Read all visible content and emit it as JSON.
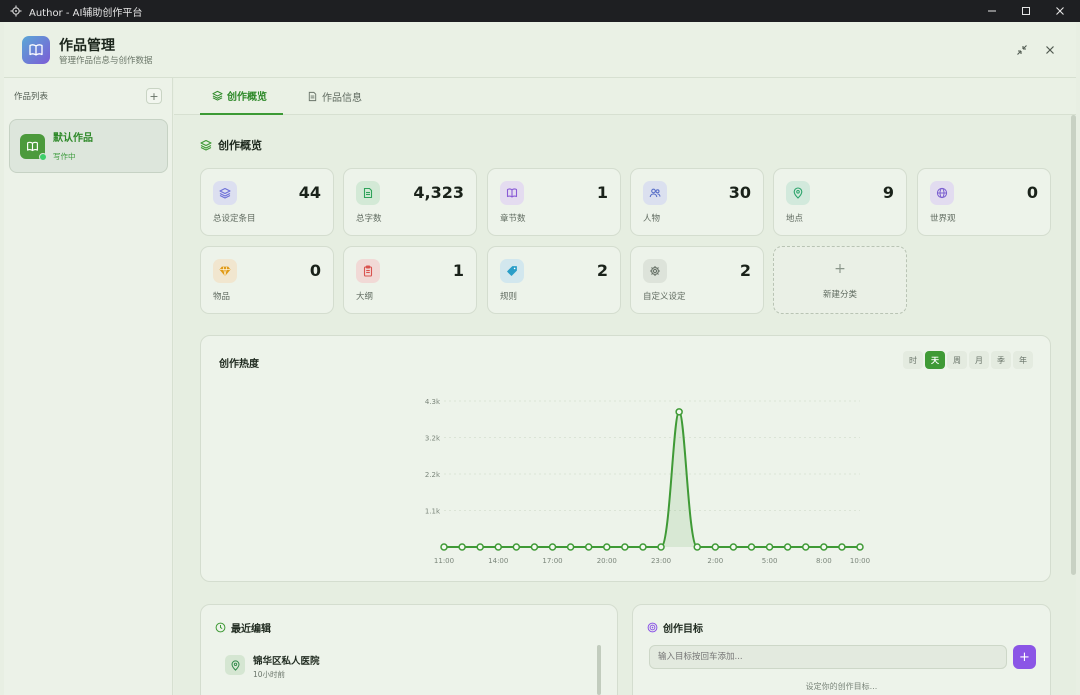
{
  "window": {
    "title": "Author - AI辅助创作平台"
  },
  "header": {
    "title": "作品管理",
    "subtitle": "管理作品信息与创作数据"
  },
  "sidebar": {
    "title": "作品列表",
    "add_label": "+",
    "works": [
      {
        "name": "默认作品",
        "status": "写作中"
      }
    ]
  },
  "tabs": [
    {
      "label": "创作概览",
      "active": true
    },
    {
      "label": "作品信息",
      "active": false
    }
  ],
  "overview": {
    "title": "创作概览",
    "stats": [
      {
        "label": "总设定条目",
        "value": "44",
        "icon": "layers-icon",
        "color": "#6d6fd8",
        "bg": "#dcdff0"
      },
      {
        "label": "总字数",
        "value": "4,323",
        "icon": "document-icon",
        "color": "#2fa35a",
        "bg": "#d3e9d6"
      },
      {
        "label": "章节数",
        "value": "1",
        "icon": "book-icon",
        "color": "#8a5cd6",
        "bg": "#e4dcf0"
      },
      {
        "label": "人物",
        "value": "30",
        "icon": "users-icon",
        "color": "#5a70c8",
        "bg": "#dbe0ef"
      },
      {
        "label": "地点",
        "value": "9",
        "icon": "map-pin-icon",
        "color": "#2aa36a",
        "bg": "#d2e9dc"
      },
      {
        "label": "世界观",
        "value": "0",
        "icon": "globe-icon",
        "color": "#7b5fd0",
        "bg": "#e2dcf0"
      },
      {
        "label": "物品",
        "value": "0",
        "icon": "gem-icon",
        "color": "#e09a18",
        "bg": "#f1e6cf"
      },
      {
        "label": "大纲",
        "value": "1",
        "icon": "clipboard-icon",
        "color": "#d9534f",
        "bg": "#f1d9d6"
      },
      {
        "label": "规则",
        "value": "2",
        "icon": "tag-icon",
        "color": "#2a9ec8",
        "bg": "#d2e7ee"
      },
      {
        "label": "自定义设定",
        "value": "2",
        "icon": "gear-icon",
        "color": "#6a746a",
        "bg": "#dde3da"
      }
    ],
    "new_category": {
      "plus": "+",
      "label": "新建分类"
    }
  },
  "heat_chart": {
    "title": "创作热度",
    "ranges": [
      {
        "label": "时",
        "active": false
      },
      {
        "label": "天",
        "active": true
      },
      {
        "label": "周",
        "active": false
      },
      {
        "label": "月",
        "active": false
      },
      {
        "label": "季",
        "active": false
      },
      {
        "label": "年",
        "active": false
      }
    ]
  },
  "chart_data": {
    "type": "area",
    "title": "创作热度",
    "x": [
      "11:00",
      "12:00",
      "13:00",
      "14:00",
      "15:00",
      "16:00",
      "17:00",
      "18:00",
      "19:00",
      "20:00",
      "21:00",
      "22:00",
      "23:00",
      "00:00",
      "1:00",
      "2:00",
      "3:00",
      "4:00",
      "5:00",
      "6:00",
      "7:00",
      "8:00",
      "9:00",
      "10:00"
    ],
    "x_tick_labels": [
      "11:00",
      "14:00",
      "17:00",
      "20:00",
      "23:00",
      "2:00",
      "5:00",
      "8:00",
      "10:00"
    ],
    "series": [
      {
        "values": [
          0,
          0,
          0,
          0,
          0,
          0,
          0,
          0,
          0,
          0,
          0,
          0,
          0,
          4000,
          0,
          0,
          0,
          0,
          0,
          0,
          0,
          0,
          0,
          0
        ]
      }
    ],
    "y_ticks": [
      "1.1k",
      "2.2k",
      "3.2k",
      "4.3k"
    ],
    "y_tick_values": [
      1080,
      2160,
      3240,
      4320
    ],
    "ylim": [
      0,
      4320
    ],
    "grid": true,
    "color": "#3f9a36"
  },
  "recent": {
    "title": "最近编辑",
    "items": [
      {
        "name": "锦华区私人医院",
        "time": "10小时前"
      }
    ]
  },
  "goals": {
    "title": "创作目标",
    "input_placeholder": "输入目标按回车添加...",
    "add_label": "+",
    "empty_text": "设定你的创作目标..."
  }
}
